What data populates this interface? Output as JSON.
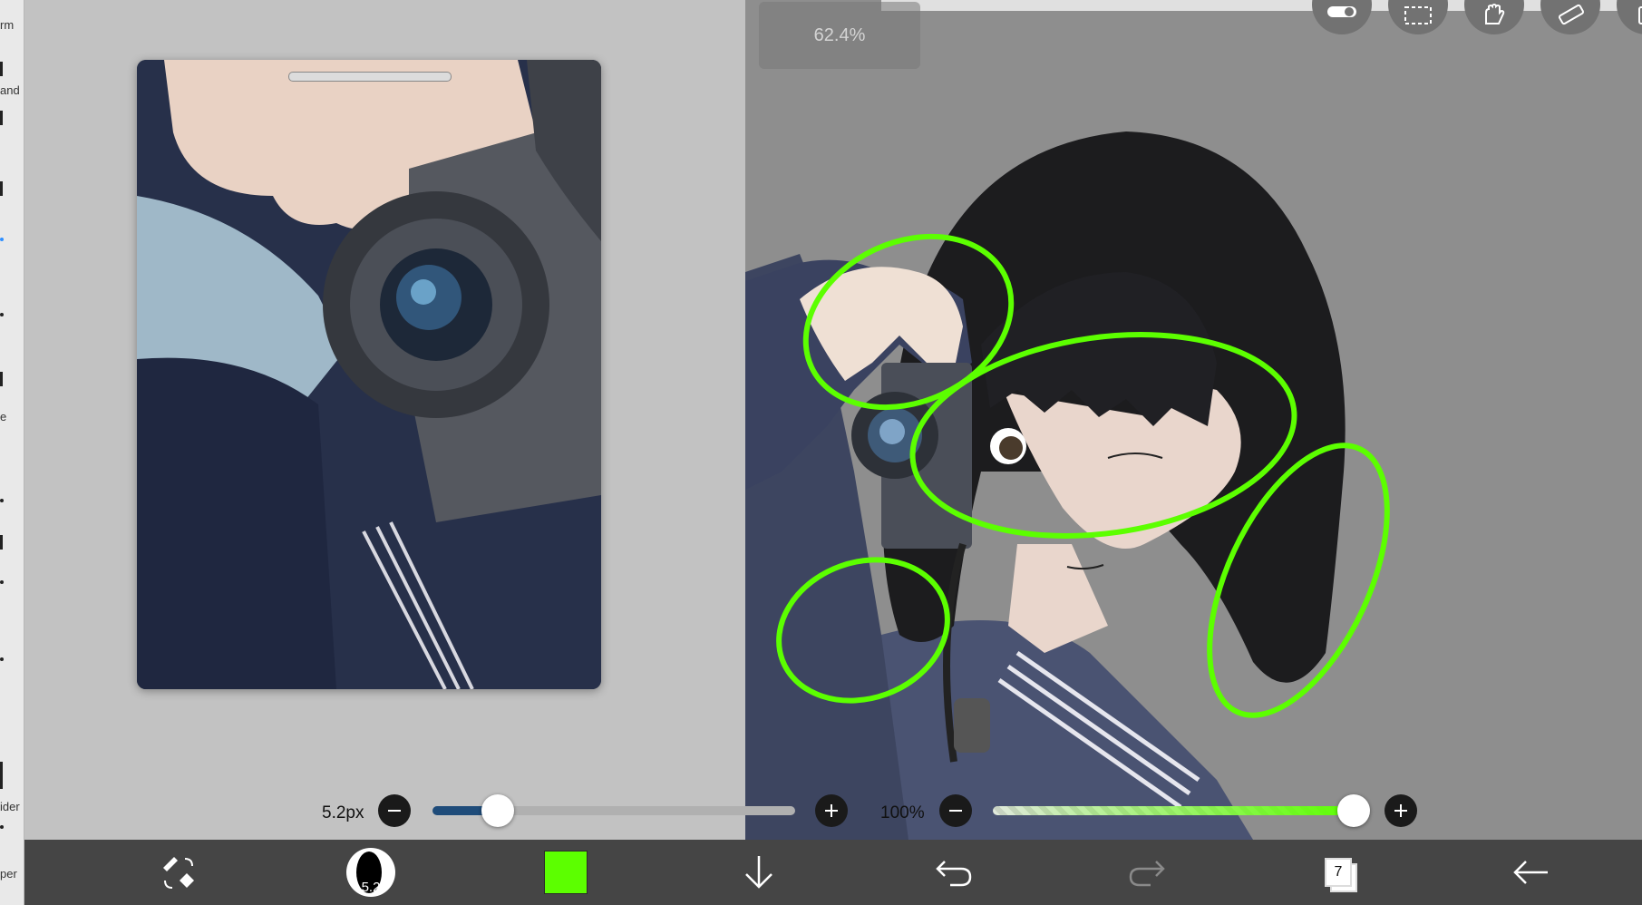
{
  "sidebar": {
    "labels": [
      "rm",
      "and",
      "e",
      "ider",
      "per"
    ]
  },
  "canvas": {
    "zoom": "62.4%"
  },
  "top_tools": [
    {
      "name": "toggle-tool"
    },
    {
      "name": "selection-tool"
    },
    {
      "name": "hand-tool"
    },
    {
      "name": "ruler-tool"
    }
  ],
  "sliders": {
    "brush_size": {
      "label": "5.2px",
      "value_fraction": 0.18
    },
    "opacity": {
      "label": "100%",
      "value_fraction": 1.0
    }
  },
  "toolbar": {
    "brush_size_badge": "5.2",
    "current_color": "#5cff00",
    "layer_count": "7"
  },
  "colors": {
    "accent_brush_track": "#1f4c7a",
    "opacity_track": "#5cff00",
    "stroke_color": "#5cff00"
  }
}
